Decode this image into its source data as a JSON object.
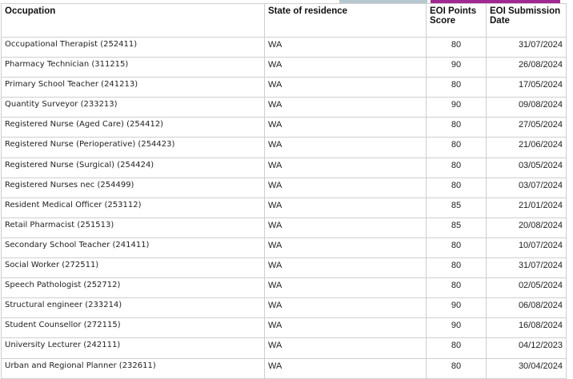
{
  "headers": {
    "occupation": "Occupation",
    "state": "State of residence",
    "score": "EOI Points Score",
    "date": "EOI Submission Date"
  },
  "rows": [
    {
      "occupation": "Occupational Therapist (252411)",
      "state": "WA",
      "score": "80",
      "date": "31/07/2024"
    },
    {
      "occupation": "Pharmacy Technician (311215)",
      "state": "WA",
      "score": "90",
      "date": "26/08/2024"
    },
    {
      "occupation": "Primary School Teacher (241213)",
      "state": "WA",
      "score": "80",
      "date": "17/05/2024"
    },
    {
      "occupation": "Quantity Surveyor (233213)",
      "state": "WA",
      "score": "90",
      "date": "09/08/2024"
    },
    {
      "occupation": "Registered Nurse (Aged Care) (254412)",
      "state": "WA",
      "score": "80",
      "date": "27/05/2024"
    },
    {
      "occupation": "Registered Nurse (Perioperative) (254423)",
      "state": "WA",
      "score": "80",
      "date": "21/06/2024"
    },
    {
      "occupation": "Registered Nurse (Surgical) (254424)",
      "state": "WA",
      "score": "80",
      "date": "03/05/2024"
    },
    {
      "occupation": "Registered Nurses nec (254499)",
      "state": "WA",
      "score": "80",
      "date": "03/07/2024"
    },
    {
      "occupation": "Resident Medical Officer (253112)",
      "state": "WA",
      "score": "85",
      "date": "21/01/2024"
    },
    {
      "occupation": "Retail Pharmacist (251513)",
      "state": "WA",
      "score": "85",
      "date": "20/08/2024"
    },
    {
      "occupation": "Secondary School Teacher (241411)",
      "state": "WA",
      "score": "80",
      "date": "10/07/2024"
    },
    {
      "occupation": "Social Worker (272511)",
      "state": "WA",
      "score": "80",
      "date": "31/07/2024"
    },
    {
      "occupation": "Speech Pathologist (252712)",
      "state": "WA",
      "score": "80",
      "date": "02/05/2024"
    },
    {
      "occupation": "Structural engineer (233214)",
      "state": "WA",
      "score": "90",
      "date": "06/08/2024"
    },
    {
      "occupation": "Student Counsellor (272115)",
      "state": "WA",
      "score": "90",
      "date": "16/08/2024"
    },
    {
      "occupation": "University Lecturer (242111)",
      "state": "WA",
      "score": "80",
      "date": "04/12/2023"
    },
    {
      "occupation": "Urban and Regional Planner (232611)",
      "state": "WA",
      "score": "80",
      "date": "30/04/2024"
    }
  ],
  "colors": {
    "tab_grey": "#b7c7d0",
    "tab_purple": "#a0288f",
    "border": "#cfcfcf"
  }
}
